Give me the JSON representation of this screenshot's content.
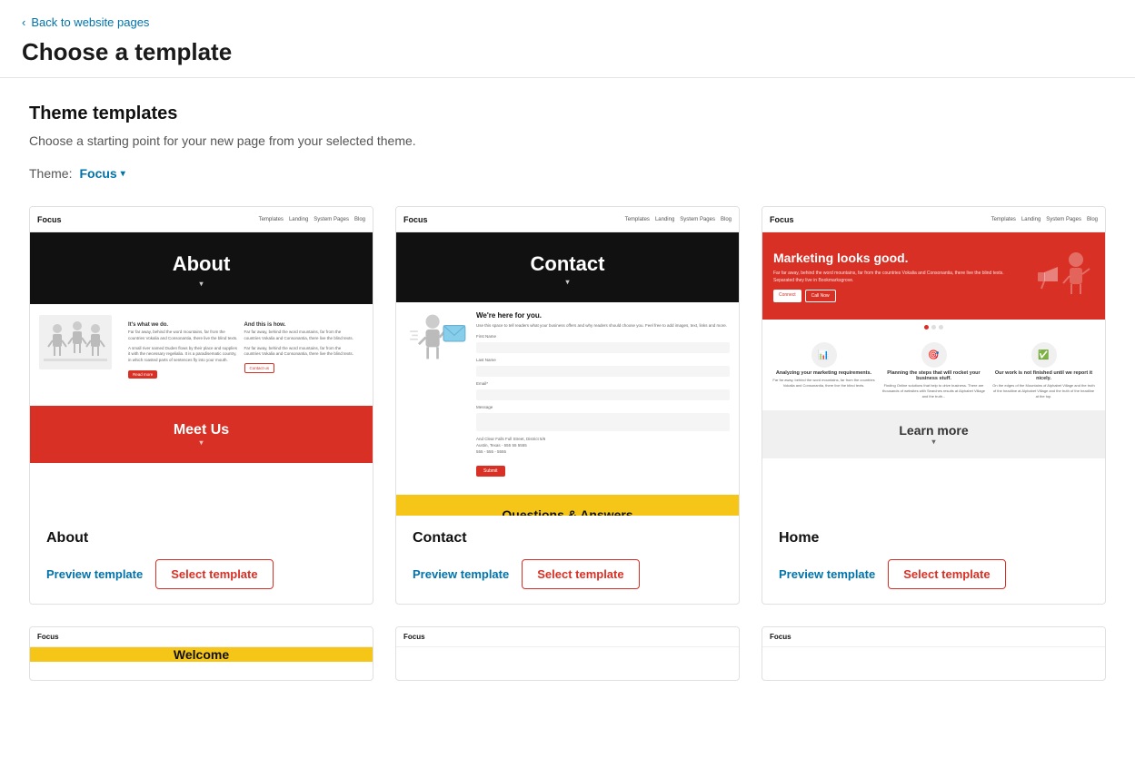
{
  "nav": {
    "back_label": "Back to website pages"
  },
  "header": {
    "title": "Choose a template"
  },
  "section": {
    "title": "Theme templates",
    "description": "Choose a starting point for your new page from your selected theme.",
    "theme_label": "Theme:",
    "theme_value": "Focus"
  },
  "templates": [
    {
      "id": "about",
      "name": "About",
      "preview_label": "Preview template",
      "select_label": "Select template",
      "type": "about"
    },
    {
      "id": "contact",
      "name": "Contact",
      "preview_label": "Preview template",
      "select_label": "Select template",
      "type": "contact"
    },
    {
      "id": "home",
      "name": "Home",
      "preview_label": "Preview template",
      "select_label": "Select template",
      "type": "home"
    }
  ],
  "bottom_templates": [
    {
      "id": "b1",
      "color": "yellow",
      "logo": "Focus"
    },
    {
      "id": "b2",
      "color": "dark",
      "logo": "Focus"
    },
    {
      "id": "b3",
      "color": "red",
      "logo": "Focus"
    }
  ],
  "icons": {
    "back_chevron": "‹",
    "chevron_down": "▾"
  }
}
